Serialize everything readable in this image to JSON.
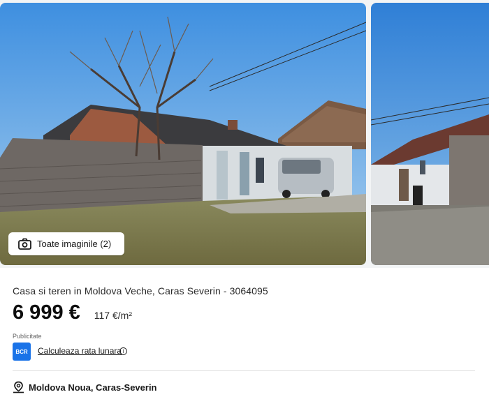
{
  "gallery": {
    "all_images_label": "Toate imaginile (2)"
  },
  "listing": {
    "title": "Casa si teren in Moldova Veche, Caras Severin - 3064095",
    "price": "6 999 €",
    "price_per_sqm": "117 €/m²",
    "location": "Moldova Noua, Caras-Severin"
  },
  "ad": {
    "label": "Publicitate",
    "bank_logo_text": "BCR",
    "calc_link": "Calculeaza rata lunara",
    "info_symbol": "i"
  },
  "colors": {
    "bank_blue": "#1a73e8",
    "sky": "#4f9be0"
  },
  "icons": {
    "camera": "camera-icon",
    "pin": "map-pin-icon",
    "info": "info-icon"
  }
}
